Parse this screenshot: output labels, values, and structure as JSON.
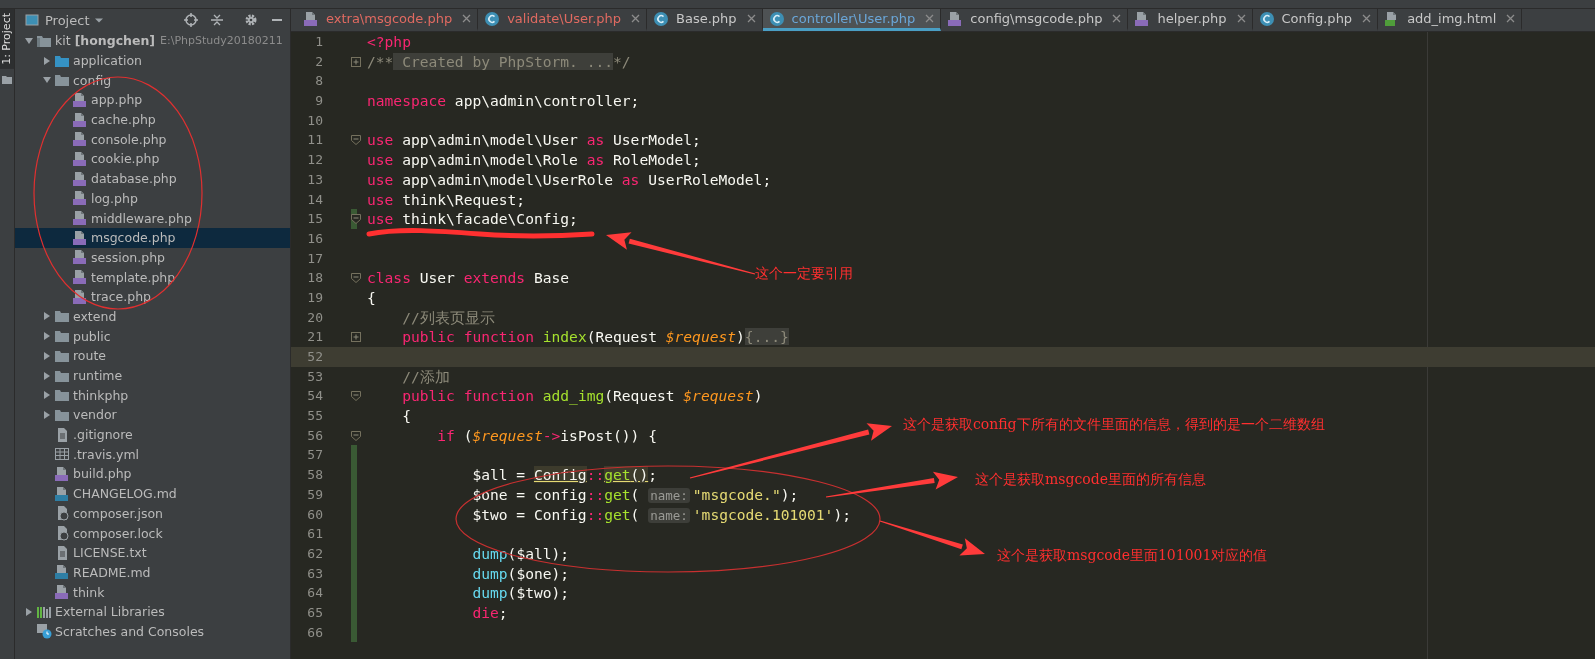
{
  "tool_strip": {
    "label": "1: Project"
  },
  "project_panel": {
    "title": "Project",
    "tree": [
      {
        "label": "kit",
        "branch": "[hongchen]",
        "path": "E:\\PhpStudy20180211",
        "kind": "module",
        "expanded": true,
        "selected": false,
        "children": [
          {
            "label": "application",
            "kind": "source-folder",
            "expanded": false,
            "selected": false
          },
          {
            "label": "config",
            "kind": "folder",
            "expanded": true,
            "selected": false,
            "children": [
              {
                "label": "app.php",
                "kind": "php",
                "selected": false
              },
              {
                "label": "cache.php",
                "kind": "php",
                "selected": false
              },
              {
                "label": "console.php",
                "kind": "php",
                "selected": false
              },
              {
                "label": "cookie.php",
                "kind": "php",
                "selected": false
              },
              {
                "label": "database.php",
                "kind": "php",
                "selected": false
              },
              {
                "label": "log.php",
                "kind": "php",
                "selected": false
              },
              {
                "label": "middleware.php",
                "kind": "php",
                "selected": false
              },
              {
                "label": "msgcode.php",
                "kind": "php",
                "selected": true
              },
              {
                "label": "session.php",
                "kind": "php",
                "selected": false
              },
              {
                "label": "template.php",
                "kind": "php",
                "selected": false
              },
              {
                "label": "trace.php",
                "kind": "php",
                "selected": false
              }
            ]
          },
          {
            "label": "extend",
            "kind": "folder",
            "expanded": false,
            "selected": false
          },
          {
            "label": "public",
            "kind": "folder",
            "expanded": false,
            "selected": false
          },
          {
            "label": "route",
            "kind": "folder",
            "expanded": false,
            "selected": false
          },
          {
            "label": "runtime",
            "kind": "folder",
            "expanded": false,
            "selected": false
          },
          {
            "label": "thinkphp",
            "kind": "folder",
            "expanded": false,
            "selected": false
          },
          {
            "label": "vendor",
            "kind": "folder",
            "expanded": false,
            "selected": false
          },
          {
            "label": ".gitignore",
            "kind": "text",
            "selected": false
          },
          {
            "label": ".travis.yml",
            "kind": "table",
            "selected": false
          },
          {
            "label": "build.php",
            "kind": "php",
            "selected": false
          },
          {
            "label": "CHANGELOG.md",
            "kind": "md",
            "selected": false
          },
          {
            "label": "composer.json",
            "kind": "json",
            "selected": false
          },
          {
            "label": "composer.lock",
            "kind": "json",
            "selected": false
          },
          {
            "label": "LICENSE.txt",
            "kind": "text",
            "selected": false
          },
          {
            "label": "README.md",
            "kind": "md",
            "selected": false
          },
          {
            "label": "think",
            "kind": "php",
            "selected": false
          }
        ]
      },
      {
        "label": "External Libraries",
        "kind": "library",
        "expanded": false,
        "selected": false
      },
      {
        "label": "Scratches and Consoles",
        "kind": "scratch",
        "selected": false
      }
    ]
  },
  "tabs": [
    {
      "label": "extra\\msgcode.php",
      "kind": "php",
      "has_errors": true,
      "modified": false,
      "selected": false
    },
    {
      "label": "validate\\User.php",
      "kind": "class",
      "has_errors": true,
      "modified": false,
      "selected": false
    },
    {
      "label": "Base.php",
      "kind": "class",
      "has_errors": false,
      "modified": false,
      "selected": false
    },
    {
      "label": "controller\\User.php",
      "kind": "class",
      "has_errors": false,
      "modified": true,
      "selected": true
    },
    {
      "label": "config\\msgcode.php",
      "kind": "php",
      "has_errors": false,
      "modified": false,
      "selected": false
    },
    {
      "label": "helper.php",
      "kind": "php",
      "has_errors": false,
      "modified": false,
      "selected": false
    },
    {
      "label": "Config.php",
      "kind": "class",
      "has_errors": false,
      "modified": false,
      "selected": false
    },
    {
      "label": "add_img.html",
      "kind": "html",
      "has_errors": false,
      "modified": false,
      "selected": false
    }
  ],
  "editor": {
    "lines": [
      {
        "number": "1",
        "changed": false,
        "current": false,
        "tokens": [
          {
            "kind": "kw",
            "text": "<?php"
          }
        ]
      },
      {
        "number": "2",
        "folded": true,
        "changed": false,
        "current": false,
        "tokens": [
          {
            "kind": "comment",
            "text": "/**"
          },
          {
            "kind": "folded",
            "text": " Created by PhpStorm. ..."
          },
          {
            "kind": "comment",
            "text": "*/"
          }
        ]
      },
      {
        "number": "8",
        "changed": false,
        "current": false
      },
      {
        "number": "9",
        "changed": false,
        "current": false,
        "tokens": [
          {
            "kind": "kw",
            "text": "namespace"
          },
          {
            "kind": "plain",
            "text": " app\\admin\\controller;"
          }
        ]
      },
      {
        "number": "10",
        "changed": false,
        "current": false
      },
      {
        "number": "11",
        "folded": false,
        "changed": false,
        "current": false,
        "tokens": [
          {
            "kind": "kw",
            "text": "use"
          },
          {
            "kind": "plain",
            "text": " app\\admin\\model\\User "
          },
          {
            "kind": "kw",
            "text": "as"
          },
          {
            "kind": "plain",
            "text": " UserModel;"
          }
        ]
      },
      {
        "number": "12",
        "changed": false,
        "current": false,
        "tokens": [
          {
            "kind": "kw",
            "text": "use"
          },
          {
            "kind": "plain",
            "text": " app\\admin\\model\\Role "
          },
          {
            "kind": "kw",
            "text": "as"
          },
          {
            "kind": "plain",
            "text": " RoleModel;"
          }
        ]
      },
      {
        "number": "13",
        "changed": false,
        "current": false,
        "tokens": [
          {
            "kind": "kw",
            "text": "use"
          },
          {
            "kind": "plain",
            "text": " app\\admin\\model\\UserRole "
          },
          {
            "kind": "kw",
            "text": "as"
          },
          {
            "kind": "plain",
            "text": " UserRoleModel;"
          }
        ]
      },
      {
        "number": "14",
        "changed": false,
        "current": false,
        "tokens": [
          {
            "kind": "kw",
            "text": "use"
          },
          {
            "kind": "plain",
            "text": " think\\Request;"
          }
        ]
      },
      {
        "number": "15",
        "folded": false,
        "changed": true,
        "current": false,
        "tokens": [
          {
            "kind": "kw",
            "text": "use"
          },
          {
            "kind": "plain",
            "text": " think\\facade\\Config;"
          }
        ]
      },
      {
        "number": "16",
        "changed": false,
        "current": false
      },
      {
        "number": "17",
        "changed": false,
        "current": false
      },
      {
        "number": "18",
        "folded": false,
        "changed": false,
        "current": false,
        "tokens": [
          {
            "kind": "kw",
            "text": "class"
          },
          {
            "kind": "plain",
            "text": " User "
          },
          {
            "kind": "kw",
            "text": "extends"
          },
          {
            "kind": "plain",
            "text": " Base"
          }
        ]
      },
      {
        "number": "19",
        "changed": false,
        "current": false,
        "tokens": [
          {
            "kind": "plain",
            "text": "{"
          }
        ]
      },
      {
        "number": "20",
        "changed": false,
        "current": false,
        "tokens": [
          {
            "kind": "comment",
            "text": "    //列表页显示"
          }
        ]
      },
      {
        "number": "21",
        "folded": true,
        "changed": false,
        "current": false,
        "tokens": [
          {
            "kind": "kw",
            "text": "    public function "
          },
          {
            "kind": "fn",
            "text": "index"
          },
          {
            "kind": "plain",
            "text": "(Request "
          },
          {
            "kind": "var",
            "text": "$request"
          },
          {
            "kind": "plain",
            "text": ")"
          },
          {
            "kind": "folded",
            "text": "{...}"
          }
        ]
      },
      {
        "number": "52",
        "changed": false,
        "current": true
      },
      {
        "number": "53",
        "changed": false,
        "current": false,
        "tokens": [
          {
            "kind": "comment",
            "text": "    //添加"
          }
        ]
      },
      {
        "number": "54",
        "folded": false,
        "changed": false,
        "current": false,
        "tokens": [
          {
            "kind": "kw",
            "text": "    public function "
          },
          {
            "kind": "fn",
            "text": "add_img"
          },
          {
            "kind": "plain",
            "text": "(Request "
          },
          {
            "kind": "var",
            "text": "$request"
          },
          {
            "kind": "plain",
            "text": ")"
          }
        ]
      },
      {
        "number": "55",
        "changed": false,
        "current": false,
        "tokens": [
          {
            "kind": "plain",
            "text": "    {"
          }
        ]
      },
      {
        "number": "56",
        "folded": false,
        "changed": false,
        "current": false,
        "tokens": [
          {
            "kind": "kw",
            "text": "        if"
          },
          {
            "kind": "plain",
            "text": " ("
          },
          {
            "kind": "var",
            "text": "$request"
          },
          {
            "kind": "op",
            "text": "->"
          },
          {
            "kind": "plain",
            "text": "isPost()) {"
          }
        ]
      },
      {
        "number": "57",
        "changed": true,
        "current": false
      },
      {
        "number": "58",
        "changed": true,
        "current": false,
        "tokens": [
          {
            "kind": "plain",
            "text": "            $all = "
          },
          {
            "kind": "usage",
            "text": "Config"
          },
          {
            "kind": "op",
            "text": "::"
          },
          {
            "kind": "usage-fn",
            "text": "get"
          },
          {
            "kind": "usage",
            "text": "()"
          },
          {
            "kind": "plain",
            "text": ";"
          }
        ]
      },
      {
        "number": "59",
        "changed": true,
        "current": false,
        "tokens": [
          {
            "kind": "plain",
            "text": "            $one = config"
          },
          {
            "kind": "op",
            "text": "::"
          },
          {
            "kind": "fn",
            "text": "get"
          },
          {
            "kind": "plain",
            "text": "( "
          },
          {
            "kind": "hint",
            "text": "name:"
          },
          {
            "kind": "str",
            "text": "\"msgcode.\""
          },
          {
            "kind": "plain",
            "text": ");"
          }
        ]
      },
      {
        "number": "60",
        "changed": true,
        "current": false,
        "tokens": [
          {
            "kind": "plain",
            "text": "            $two = Config"
          },
          {
            "kind": "op",
            "text": "::"
          },
          {
            "kind": "fn",
            "text": "get"
          },
          {
            "kind": "plain",
            "text": "( "
          },
          {
            "kind": "hint",
            "text": "name:"
          },
          {
            "kind": "str",
            "text": "'msgcode.101001'"
          },
          {
            "kind": "plain",
            "text": ");"
          }
        ]
      },
      {
        "number": "61",
        "changed": true,
        "current": false
      },
      {
        "number": "62",
        "changed": true,
        "current": false,
        "tokens": [
          {
            "kind": "call",
            "text": "            dump"
          },
          {
            "kind": "plain",
            "text": "($all);"
          }
        ]
      },
      {
        "number": "63",
        "changed": true,
        "current": false,
        "tokens": [
          {
            "kind": "call",
            "text": "            dump"
          },
          {
            "kind": "plain",
            "text": "($one);"
          }
        ]
      },
      {
        "number": "64",
        "changed": true,
        "current": false,
        "tokens": [
          {
            "kind": "call",
            "text": "            dump"
          },
          {
            "kind": "plain",
            "text": "($two);"
          }
        ]
      },
      {
        "number": "65",
        "changed": true,
        "current": false,
        "tokens": [
          {
            "kind": "kw",
            "text": "            die"
          },
          {
            "kind": "plain",
            "text": ";"
          }
        ]
      },
      {
        "number": "66",
        "changed": true,
        "current": false
      }
    ]
  },
  "annotations": [
    {
      "text": "这个一定要引用"
    },
    {
      "text": "这个是获取config下所有的文件里面的信息，得到的是一个二维数组"
    },
    {
      "text": "这个是获取msgcode里面的所有信息"
    },
    {
      "text": "这个是获取msgcode里面101001对应的值"
    }
  ]
}
